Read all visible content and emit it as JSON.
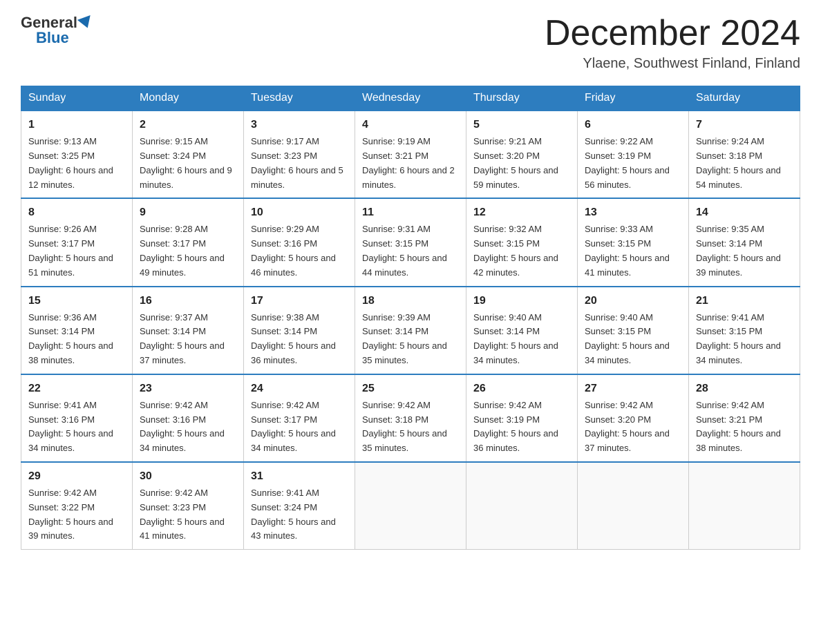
{
  "header": {
    "logo": {
      "general": "General",
      "blue": "Blue"
    },
    "title": "December 2024",
    "location": "Ylaene, Southwest Finland, Finland"
  },
  "days_of_week": [
    "Sunday",
    "Monday",
    "Tuesday",
    "Wednesday",
    "Thursday",
    "Friday",
    "Saturday"
  ],
  "weeks": [
    [
      {
        "day": "1",
        "sunrise": "9:13 AM",
        "sunset": "3:25 PM",
        "daylight": "6 hours and 12 minutes."
      },
      {
        "day": "2",
        "sunrise": "9:15 AM",
        "sunset": "3:24 PM",
        "daylight": "6 hours and 9 minutes."
      },
      {
        "day": "3",
        "sunrise": "9:17 AM",
        "sunset": "3:23 PM",
        "daylight": "6 hours and 5 minutes."
      },
      {
        "day": "4",
        "sunrise": "9:19 AM",
        "sunset": "3:21 PM",
        "daylight": "6 hours and 2 minutes."
      },
      {
        "day": "5",
        "sunrise": "9:21 AM",
        "sunset": "3:20 PM",
        "daylight": "5 hours and 59 minutes."
      },
      {
        "day": "6",
        "sunrise": "9:22 AM",
        "sunset": "3:19 PM",
        "daylight": "5 hours and 56 minutes."
      },
      {
        "day": "7",
        "sunrise": "9:24 AM",
        "sunset": "3:18 PM",
        "daylight": "5 hours and 54 minutes."
      }
    ],
    [
      {
        "day": "8",
        "sunrise": "9:26 AM",
        "sunset": "3:17 PM",
        "daylight": "5 hours and 51 minutes."
      },
      {
        "day": "9",
        "sunrise": "9:28 AM",
        "sunset": "3:17 PM",
        "daylight": "5 hours and 49 minutes."
      },
      {
        "day": "10",
        "sunrise": "9:29 AM",
        "sunset": "3:16 PM",
        "daylight": "5 hours and 46 minutes."
      },
      {
        "day": "11",
        "sunrise": "9:31 AM",
        "sunset": "3:15 PM",
        "daylight": "5 hours and 44 minutes."
      },
      {
        "day": "12",
        "sunrise": "9:32 AM",
        "sunset": "3:15 PM",
        "daylight": "5 hours and 42 minutes."
      },
      {
        "day": "13",
        "sunrise": "9:33 AM",
        "sunset": "3:15 PM",
        "daylight": "5 hours and 41 minutes."
      },
      {
        "day": "14",
        "sunrise": "9:35 AM",
        "sunset": "3:14 PM",
        "daylight": "5 hours and 39 minutes."
      }
    ],
    [
      {
        "day": "15",
        "sunrise": "9:36 AM",
        "sunset": "3:14 PM",
        "daylight": "5 hours and 38 minutes."
      },
      {
        "day": "16",
        "sunrise": "9:37 AM",
        "sunset": "3:14 PM",
        "daylight": "5 hours and 37 minutes."
      },
      {
        "day": "17",
        "sunrise": "9:38 AM",
        "sunset": "3:14 PM",
        "daylight": "5 hours and 36 minutes."
      },
      {
        "day": "18",
        "sunrise": "9:39 AM",
        "sunset": "3:14 PM",
        "daylight": "5 hours and 35 minutes."
      },
      {
        "day": "19",
        "sunrise": "9:40 AM",
        "sunset": "3:14 PM",
        "daylight": "5 hours and 34 minutes."
      },
      {
        "day": "20",
        "sunrise": "9:40 AM",
        "sunset": "3:15 PM",
        "daylight": "5 hours and 34 minutes."
      },
      {
        "day": "21",
        "sunrise": "9:41 AM",
        "sunset": "3:15 PM",
        "daylight": "5 hours and 34 minutes."
      }
    ],
    [
      {
        "day": "22",
        "sunrise": "9:41 AM",
        "sunset": "3:16 PM",
        "daylight": "5 hours and 34 minutes."
      },
      {
        "day": "23",
        "sunrise": "9:42 AM",
        "sunset": "3:16 PM",
        "daylight": "5 hours and 34 minutes."
      },
      {
        "day": "24",
        "sunrise": "9:42 AM",
        "sunset": "3:17 PM",
        "daylight": "5 hours and 34 minutes."
      },
      {
        "day": "25",
        "sunrise": "9:42 AM",
        "sunset": "3:18 PM",
        "daylight": "5 hours and 35 minutes."
      },
      {
        "day": "26",
        "sunrise": "9:42 AM",
        "sunset": "3:19 PM",
        "daylight": "5 hours and 36 minutes."
      },
      {
        "day": "27",
        "sunrise": "9:42 AM",
        "sunset": "3:20 PM",
        "daylight": "5 hours and 37 minutes."
      },
      {
        "day": "28",
        "sunrise": "9:42 AM",
        "sunset": "3:21 PM",
        "daylight": "5 hours and 38 minutes."
      }
    ],
    [
      {
        "day": "29",
        "sunrise": "9:42 AM",
        "sunset": "3:22 PM",
        "daylight": "5 hours and 39 minutes."
      },
      {
        "day": "30",
        "sunrise": "9:42 AM",
        "sunset": "3:23 PM",
        "daylight": "5 hours and 41 minutes."
      },
      {
        "day": "31",
        "sunrise": "9:41 AM",
        "sunset": "3:24 PM",
        "daylight": "5 hours and 43 minutes."
      },
      null,
      null,
      null,
      null
    ]
  ]
}
